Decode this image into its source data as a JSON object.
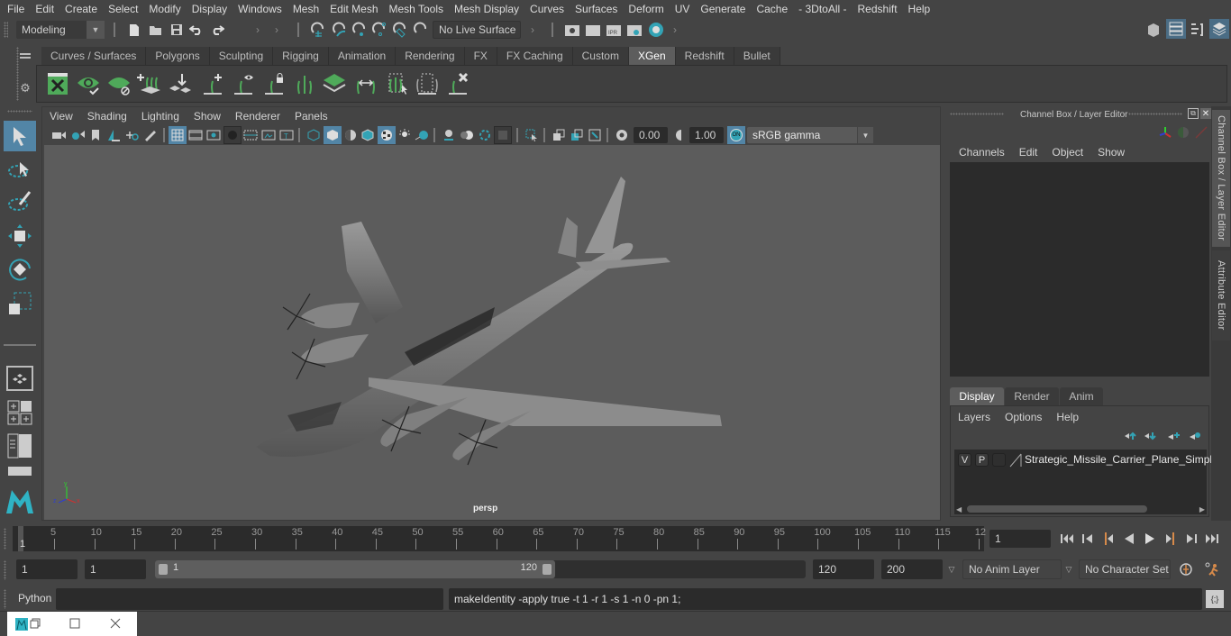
{
  "menubar": {
    "items": [
      "File",
      "Edit",
      "Create",
      "Select",
      "Modify",
      "Display",
      "Windows",
      "Mesh",
      "Edit Mesh",
      "Mesh Tools",
      "Mesh Display",
      "Curves",
      "Surfaces",
      "Deform",
      "UV",
      "Generate",
      "Cache",
      "- 3DtoAll -",
      "Redshift",
      "Help"
    ]
  },
  "statusline": {
    "mode_selector": "Modeling",
    "live_surface": "No Live Surface"
  },
  "shelf": {
    "tabs": [
      "Curves / Surfaces",
      "Polygons",
      "Sculpting",
      "Rigging",
      "Animation",
      "Rendering",
      "FX",
      "FX Caching",
      "Custom",
      "XGen",
      "Redshift",
      "Bullet"
    ],
    "active_tab": "XGen",
    "icons": [
      "xgen-description-editor-icon",
      "xgen-preview-icon",
      "xgen-clear-preview-icon",
      "add-guides-icon",
      "place-guides-icon",
      "add-or-move-guides-icon",
      "toggle-guide-visibility-icon",
      "lock-guides-icon",
      "guide-sculpt-icon",
      "convert-to-polygons-icon",
      "rebuild-guides-icon",
      "select-guides-icon",
      "guide-bounding-icon",
      "delete-guides-icon"
    ]
  },
  "viewport": {
    "menu": [
      "View",
      "Shading",
      "Lighting",
      "Show",
      "Renderer",
      "Panels"
    ],
    "exposure": "0.00",
    "gamma": "1.00",
    "color_space": "sRGB gamma",
    "color_mgmt_badge": "ON",
    "camera_label": "persp",
    "axis_labels": {
      "x": "x",
      "y": "y",
      "z": "z"
    }
  },
  "channel_box": {
    "title": "Channel Box / Layer Editor",
    "menu": [
      "Channels",
      "Edit",
      "Object",
      "Show"
    ]
  },
  "layer_editor": {
    "tabs": [
      "Display",
      "Render",
      "Anim"
    ],
    "active_tab": "Display",
    "menu": [
      "Layers",
      "Options",
      "Help"
    ],
    "layers": [
      {
        "visible": "V",
        "playback": "P",
        "name": "Strategic_Missile_Carrier_Plane_Simple_"
      }
    ]
  },
  "side_tabs": [
    "Channel Box / Layer Editor",
    "Attribute Editor"
  ],
  "timeline": {
    "ticks": [
      "5",
      "10",
      "15",
      "20",
      "25",
      "30",
      "35",
      "40",
      "45",
      "50",
      "55",
      "60",
      "65",
      "70",
      "75",
      "80",
      "85",
      "90",
      "95",
      "100",
      "105",
      "110",
      "115",
      "12"
    ],
    "current_frame_marker": "1",
    "current_frame": "1"
  },
  "range": {
    "start": "1",
    "playback_start": "1",
    "slider_start": "1",
    "slider_end": "120",
    "playback_end": "120",
    "end": "200",
    "anim_layer": "No Anim Layer",
    "character_set": "No Character Set"
  },
  "command_line": {
    "language": "Python",
    "input": "",
    "result": "makeIdentity -apply true -t 1 -r 1 -s 1 -n 0 -pn 1;"
  },
  "colors": {
    "accent_blue": "#5285a6",
    "teal_icon": "#33a3b5",
    "xgen_green": "#4faa5a",
    "playback_orange": "#d78a4a"
  }
}
